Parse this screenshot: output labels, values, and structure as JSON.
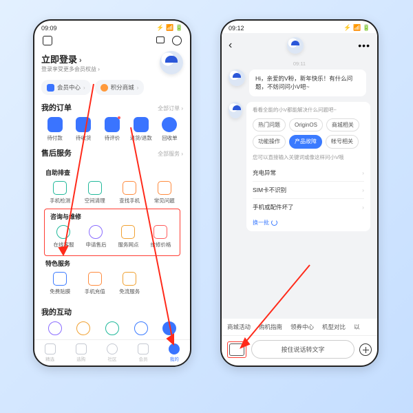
{
  "phoneA": {
    "status": {
      "time": "09:09",
      "icons": "⚙ ⚪ ⚪ ⚪",
      "right": "⚡ 📶 🔋"
    },
    "login": {
      "title": "立即登录",
      "chevron": "›",
      "subtitle": "登录享受更多会员权益 ›"
    },
    "pills": {
      "member": {
        "label": "会员中心",
        "chev": "›"
      },
      "points": {
        "label": "积分商城",
        "chev": "›"
      }
    },
    "orders": {
      "title": "我的订单",
      "more": "全部订单 ›",
      "items": [
        "待付款",
        "待收货",
        "待评价",
        "退货/退款",
        "回收单"
      ]
    },
    "after": {
      "title": "售后服务",
      "more": "全部服务 ›",
      "self": {
        "title": "自助排查",
        "items": [
          "手机检测",
          "空间清理",
          "查找手机",
          "常见问题"
        ]
      },
      "consult": {
        "title": "咨询与维修",
        "items": [
          "在线客服",
          "申请售后",
          "服务网点",
          "维修价格"
        ]
      },
      "special": {
        "title": "特色服务",
        "items": [
          "免费贴膜",
          "手机充值",
          "免流服务"
        ]
      }
    },
    "interact": {
      "title": "我的互动"
    },
    "tabs": [
      "精选",
      "选购",
      "社区",
      "会员",
      "我的"
    ]
  },
  "phoneB": {
    "status": {
      "time": "09:12",
      "icons": "⚙ ⚪ ⚪ ⚪",
      "right": "⚡ 📶 🔋"
    },
    "timestamp": "09:11",
    "greeting": "Hi，亲爱的V粉，新年快乐！有什么问题，不妨问问小V吧~",
    "botIntro": "看看全能的小V都能解决什么问题吧~",
    "chips": [
      "热门问题",
      "OriginOS",
      "商城相关",
      "功能操作",
      "产品故障",
      "帐号相关"
    ],
    "hint": "您可以直接输入关键词或像这样问小V哦",
    "questions": [
      "充电异常",
      "SIM卡不识别",
      "手机或配件坏了"
    ],
    "refresh": "换一批",
    "tags": [
      "商城活动",
      "购机指南",
      "领券中心",
      "机型对比",
      "以"
    ],
    "voice": "按住说话转文字"
  }
}
